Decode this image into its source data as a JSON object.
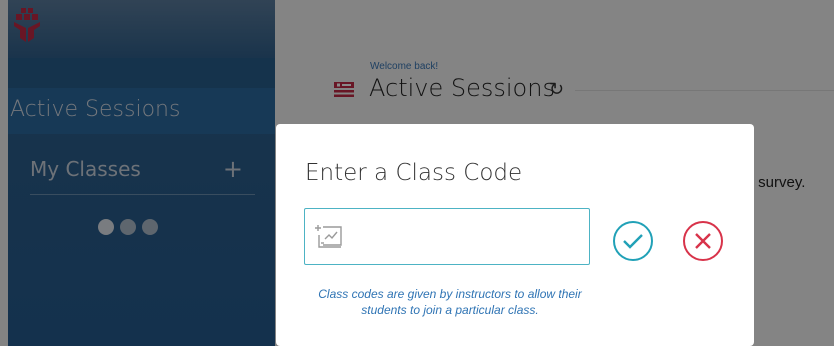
{
  "sidebar": {
    "active_sessions_label": "Active Sessions",
    "my_classes_label": "My Classes",
    "add_symbol": "+"
  },
  "main": {
    "welcome": "Welcome back!",
    "title": "Active Sessions",
    "refresh_symbol": "↻",
    "survey_text": "r survey."
  },
  "modal": {
    "title": "Enter a Class Code",
    "input_value": "",
    "hint": "Class codes are given by instructors to allow their students to join a particular class."
  },
  "colors": {
    "sidebar": "#2b6aa0",
    "accent_teal": "#21a1b7",
    "cancel_red": "#d8334a",
    "link_blue": "#2f74b4"
  },
  "icons": [
    "logo-icon",
    "sessions-icon",
    "refresh-icon",
    "add-icon",
    "class-code-icon",
    "confirm-icon",
    "cancel-icon"
  ]
}
